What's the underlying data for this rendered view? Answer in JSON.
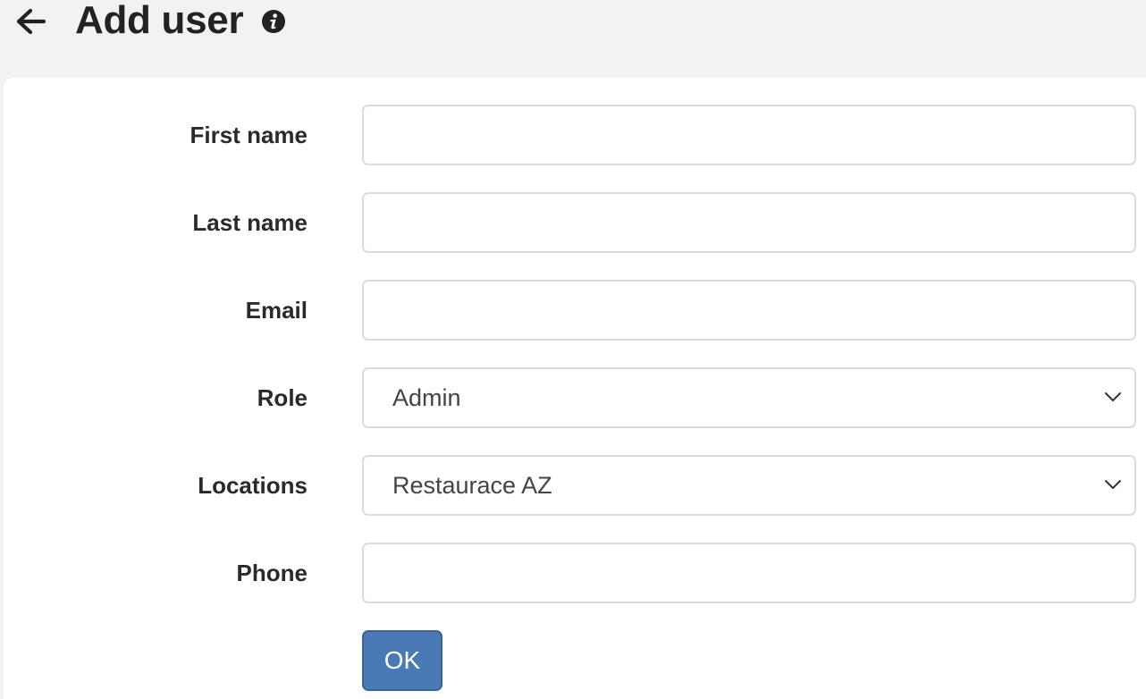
{
  "header": {
    "title": "Add user",
    "back_icon": "arrow-left-icon",
    "info_icon": "info-circle-icon"
  },
  "form": {
    "first_name": {
      "label": "First name",
      "value": ""
    },
    "last_name": {
      "label": "Last name",
      "value": ""
    },
    "email": {
      "label": "Email",
      "value": ""
    },
    "role": {
      "label": "Role",
      "selected": "Admin"
    },
    "locations": {
      "label": "Locations",
      "selected": "Restaurace AZ"
    },
    "phone": {
      "label": "Phone",
      "value": ""
    },
    "submit_label": "OK"
  },
  "colors": {
    "background": "#f2f2f2",
    "card": "#ffffff",
    "primary_button": "#4a7ab5",
    "input_border": "#dcdcdc"
  }
}
